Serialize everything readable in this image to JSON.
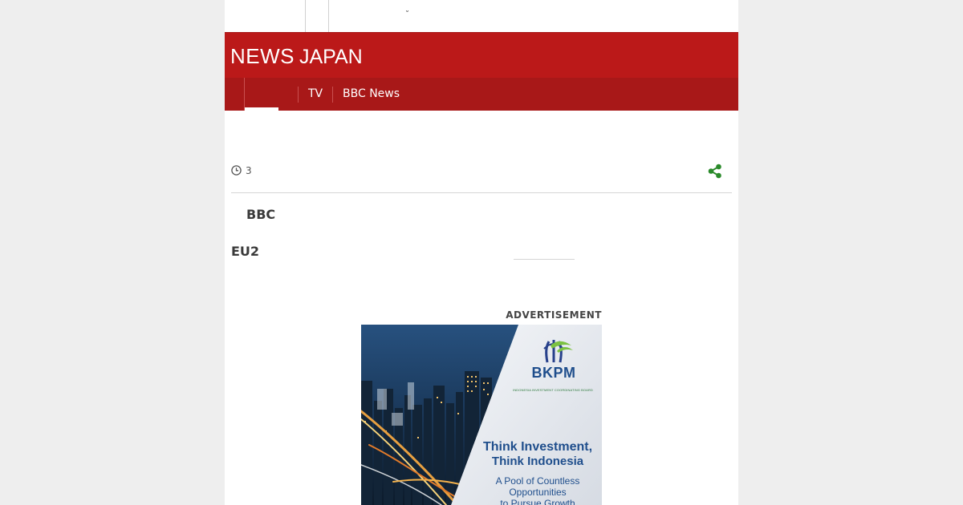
{
  "topbar": {
    "menu_glyph": "˘"
  },
  "masthead": {
    "brand_word1": "NEWS",
    "brand_word2": "JAPAN",
    "bg_color": "#bb1919"
  },
  "nav": {
    "items": [
      {
        "label": "",
        "active": true
      },
      {
        "label": ""
      },
      {
        "label": "TV"
      },
      {
        "label": "BBC News"
      }
    ]
  },
  "article": {
    "meta_count": "3",
    "clock_icon": "clock-icon",
    "share_icon": "share-icon",
    "byline": "BBC",
    "subtitle": "EU2"
  },
  "advertisement": {
    "label": "ADVERTISEMENT",
    "brand": "BKPM",
    "brand_tagline": "INDONESIA INVESTMENT COORDINATING BOARD",
    "headline_line1": "Think Investment,",
    "headline_line2": "Think Indonesia",
    "sub_line1": "A Pool of Countless",
    "sub_line2": "Opportunities",
    "sub_line3": "to Pursue Growth"
  },
  "colors": {
    "accent": "#bb1919",
    "nav": "#a81818",
    "share": "#2a8a2a",
    "ad_text": "#1f4e8c"
  }
}
